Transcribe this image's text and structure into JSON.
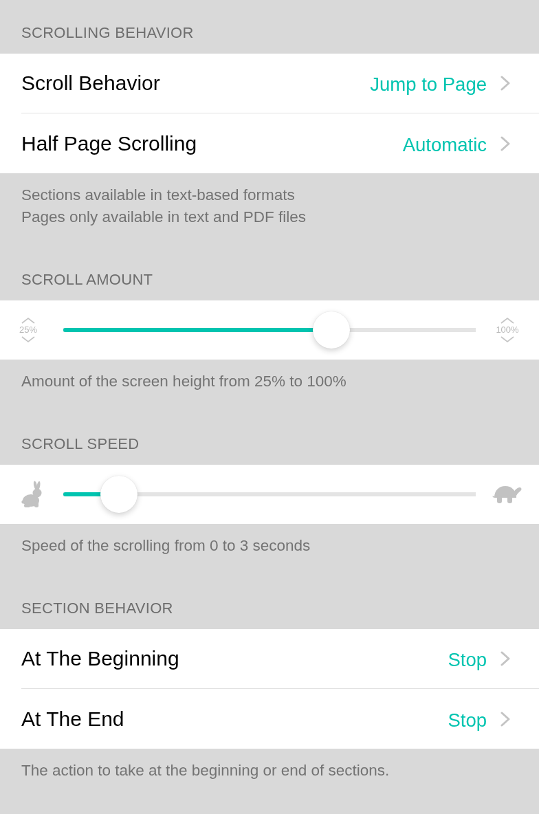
{
  "sections": [
    {
      "kind": "rows",
      "header": "SCROLLING BEHAVIOR",
      "rows": [
        {
          "label": "Scroll Behavior",
          "value": "Jump to Page"
        },
        {
          "label": "Half Page Scrolling",
          "value": "Automatic"
        }
      ],
      "footer": [
        "Sections available in text-based formats",
        "Pages only available in text and PDF files"
      ]
    },
    {
      "kind": "percent-slider",
      "header": "SCROLL AMOUNT",
      "slider": {
        "min_label": "25%",
        "max_label": "100%",
        "level": 0.65
      },
      "footer": [
        "Amount of the screen height from 25% to 100%"
      ]
    },
    {
      "kind": "speed-slider",
      "header": "SCROLL SPEED",
      "slider": {
        "level": 0.135
      },
      "footer": [
        "Speed of the scrolling from 0 to 3 seconds"
      ]
    },
    {
      "kind": "rows",
      "header": "SECTION BEHAVIOR",
      "rows": [
        {
          "label": "At The Beginning",
          "value": "Stop"
        },
        {
          "label": "At The End",
          "value": "Stop"
        }
      ],
      "footer": [
        "The action to take at the beginning or end of sections."
      ]
    }
  ]
}
